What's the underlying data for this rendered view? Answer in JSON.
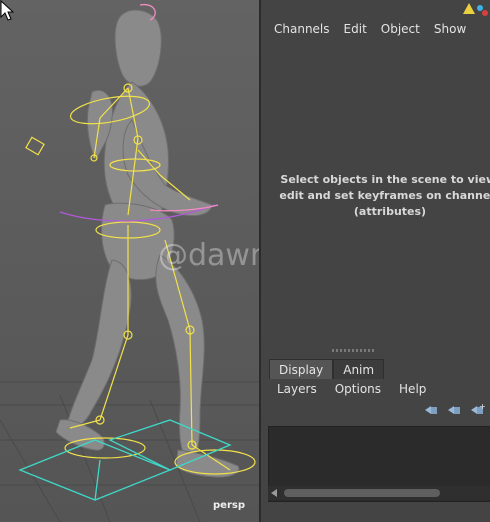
{
  "viewport": {
    "camera_label": "persp",
    "watermark": "@dawn_arc"
  },
  "channel_box": {
    "menu": [
      "Channels",
      "Edit",
      "Object",
      "Show"
    ],
    "hint": "Select objects in the scene to view, edit and set keyframes on channels (attributes)"
  },
  "layer_editor": {
    "tabs": [
      "Display",
      "Anim"
    ],
    "active_tab": "Display",
    "menu": [
      "Layers",
      "Options",
      "Help"
    ],
    "icons": [
      "new-layer-icon",
      "new-layer-selected-icon",
      "new-empty-layer-icon"
    ]
  },
  "colors": {
    "rig_yellow": "#f2e14a",
    "rig_pink": "#f08cc0",
    "rig_cyan": "#3fd8c8",
    "rig_purple": "#b05ad8"
  }
}
